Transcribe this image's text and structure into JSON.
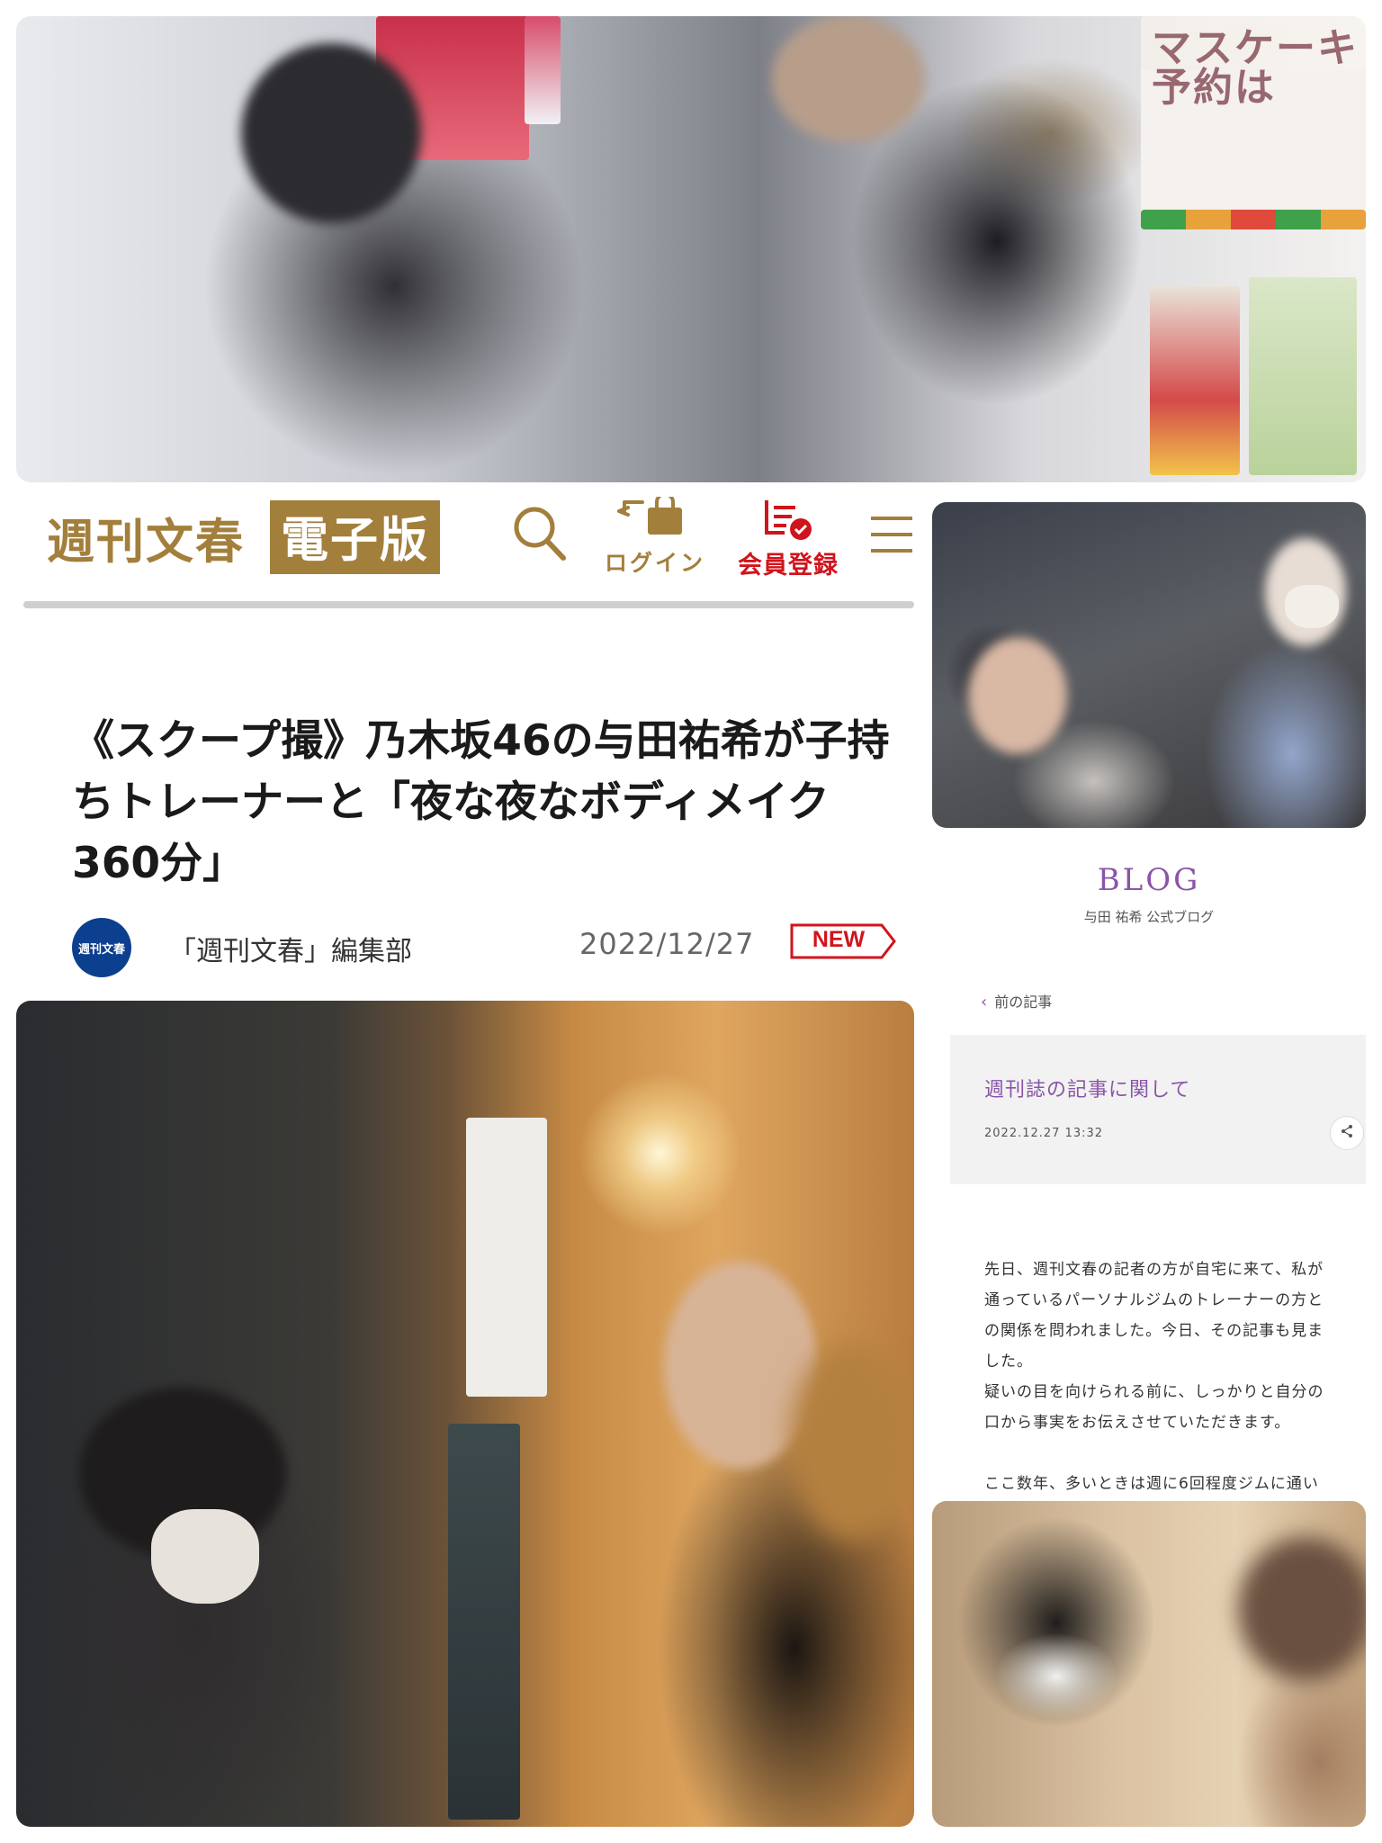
{
  "header": {
    "logo_text": "週刊文春",
    "badge_text": "電子版",
    "login_label": "ログイン",
    "register_label": "会員登録"
  },
  "article": {
    "title": "《スクープ撮》乃木坂46の与田祐希が子持ちトレーナーと「夜な夜なボディメイク360分」",
    "publisher_mark": "週刊文春",
    "author": "「週刊文春」編集部",
    "date": "2022/12/27",
    "new_badge": "NEW"
  },
  "blog": {
    "heading": "BLOG",
    "subtitle": "与田 祐希 公式ブログ",
    "prev_link": "前の記事",
    "post_title": "週刊誌の記事に関して",
    "post_datetime": "2022.12.27 13:32",
    "body_lines": [
      "先日、週刊文春の記者の方が自宅に来て、私が",
      "通っているパーソナルジムのトレーナーの方と",
      "の関係を問われました。今日、その記事も見ま",
      "した。",
      "疑いの目を向けられる前に、しっかりと自分の",
      "口から事実をお伝えさせていただきます。",
      "",
      "ここ数年、多いときは週に6回程度ジムに通い"
    ]
  },
  "photo_signage": {
    "top_right_sign": "マスケーキ予約は"
  },
  "colors": {
    "brand_gold": "#a37f3c",
    "brand_red": "#d0141c",
    "blog_purple": "#8a55a8",
    "publisher_blue": "#0d3f8f"
  },
  "icons": [
    "search-icon",
    "login-bag-icon",
    "register-list-icon",
    "menu-icon",
    "share-icon",
    "chevron-left-icon"
  ]
}
